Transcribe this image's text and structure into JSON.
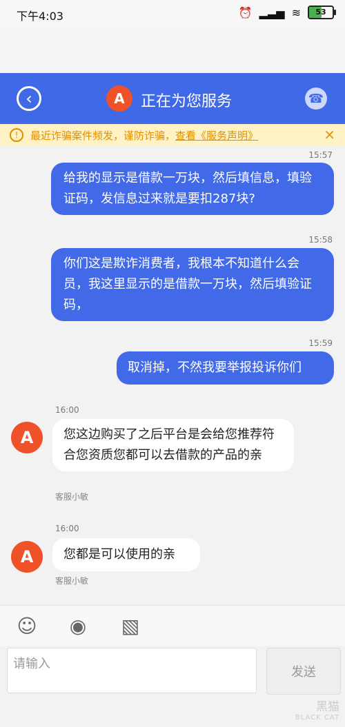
{
  "status_bar": {
    "time": "下午4:03",
    "battery": "53"
  },
  "header": {
    "back_icon": "‹",
    "title": "正在为您服务",
    "logo_icon": "A",
    "phone_icon": "☎"
  },
  "notice": {
    "icon": "!",
    "text": "最近诈骗案件频发，谨防诈骗，",
    "link": "查看《服务声明》",
    "close_icon": "×"
  },
  "messages": {
    "outgoing": [
      {
        "time": "15:57",
        "text": "给我的显示是借款一万块，然后填信息，填验证码，发信息过来就是要扣287块?"
      },
      {
        "time": "15:58",
        "text": "你们这是欺诈消费者，我根本不知道什么会员，我这里显示的是借款一万块，然后填验证码，"
      },
      {
        "time": "15:59",
        "text": "取消掉，不然我要举报投诉你们"
      }
    ],
    "incoming": [
      {
        "time": "16:00",
        "sender": "客服小敏",
        "text": "您这边购买了之后平台是会给您推荐符合您资质您都可以去借款的产品的亲"
      },
      {
        "time": "16:00",
        "sender": "客服小敏",
        "text": "您都是可以使用的亲"
      }
    ]
  },
  "input": {
    "placeholder": "请输入",
    "send_label": "发送"
  },
  "watermark": {
    "main": "黑猫",
    "sub": "BLACK CAT"
  }
}
